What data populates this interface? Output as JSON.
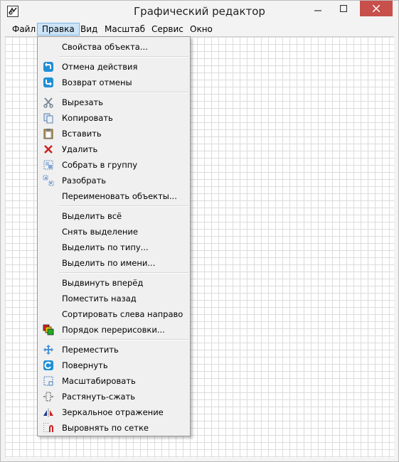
{
  "window": {
    "title": "Графический редактор"
  },
  "menubar": {
    "items": [
      {
        "label": "Файл"
      },
      {
        "label": "Правка"
      },
      {
        "label": "Вид"
      },
      {
        "label": "Масштаб"
      },
      {
        "label": "Сервис"
      },
      {
        "label": "Окно"
      }
    ],
    "active": "Правка"
  },
  "edit_menu": {
    "items": [
      {
        "label": "Свойства объекта...",
        "icon": "none"
      },
      {
        "label": "Отмена действия",
        "icon": "undo-icon"
      },
      {
        "label": "Возврат отмены",
        "icon": "redo-icon"
      },
      {
        "label": "Вырезать",
        "icon": "scissors-icon"
      },
      {
        "label": "Копировать",
        "icon": "copy-icon"
      },
      {
        "label": "Вставить",
        "icon": "paste-icon"
      },
      {
        "label": "Удалить",
        "icon": "delete-icon"
      },
      {
        "label": "Собрать в группу",
        "icon": "group-icon"
      },
      {
        "label": "Разобрать",
        "icon": "ungroup-icon"
      },
      {
        "label": "Переименовать объекты...",
        "icon": "none"
      },
      {
        "label": "Выделить всё",
        "icon": "none"
      },
      {
        "label": "Снять выделение",
        "icon": "none"
      },
      {
        "label": "Выделить по типу...",
        "icon": "none"
      },
      {
        "label": "Выделить по имени...",
        "icon": "none"
      },
      {
        "label": "Выдвинуть вперёд",
        "icon": "none"
      },
      {
        "label": "Поместить назад",
        "icon": "none"
      },
      {
        "label": "Сортировать слева направо",
        "icon": "none"
      },
      {
        "label": "Порядок перерисовки...",
        "icon": "draw-order-icon"
      },
      {
        "label": "Переместить",
        "icon": "move-icon"
      },
      {
        "label": "Повернуть",
        "icon": "rotate-icon"
      },
      {
        "label": "Масштабировать",
        "icon": "scale-icon"
      },
      {
        "label": "Растянуть-сжать",
        "icon": "stretch-icon"
      },
      {
        "label": "Зеркальное отражение",
        "icon": "mirror-icon"
      },
      {
        "label": "Выровнять по сетке",
        "icon": "snap-to-grid-icon"
      }
    ]
  },
  "colors": {
    "close_button": "#c7504b",
    "menu_highlight": "#cce4f7",
    "grid_line": "#dcdcdc"
  }
}
